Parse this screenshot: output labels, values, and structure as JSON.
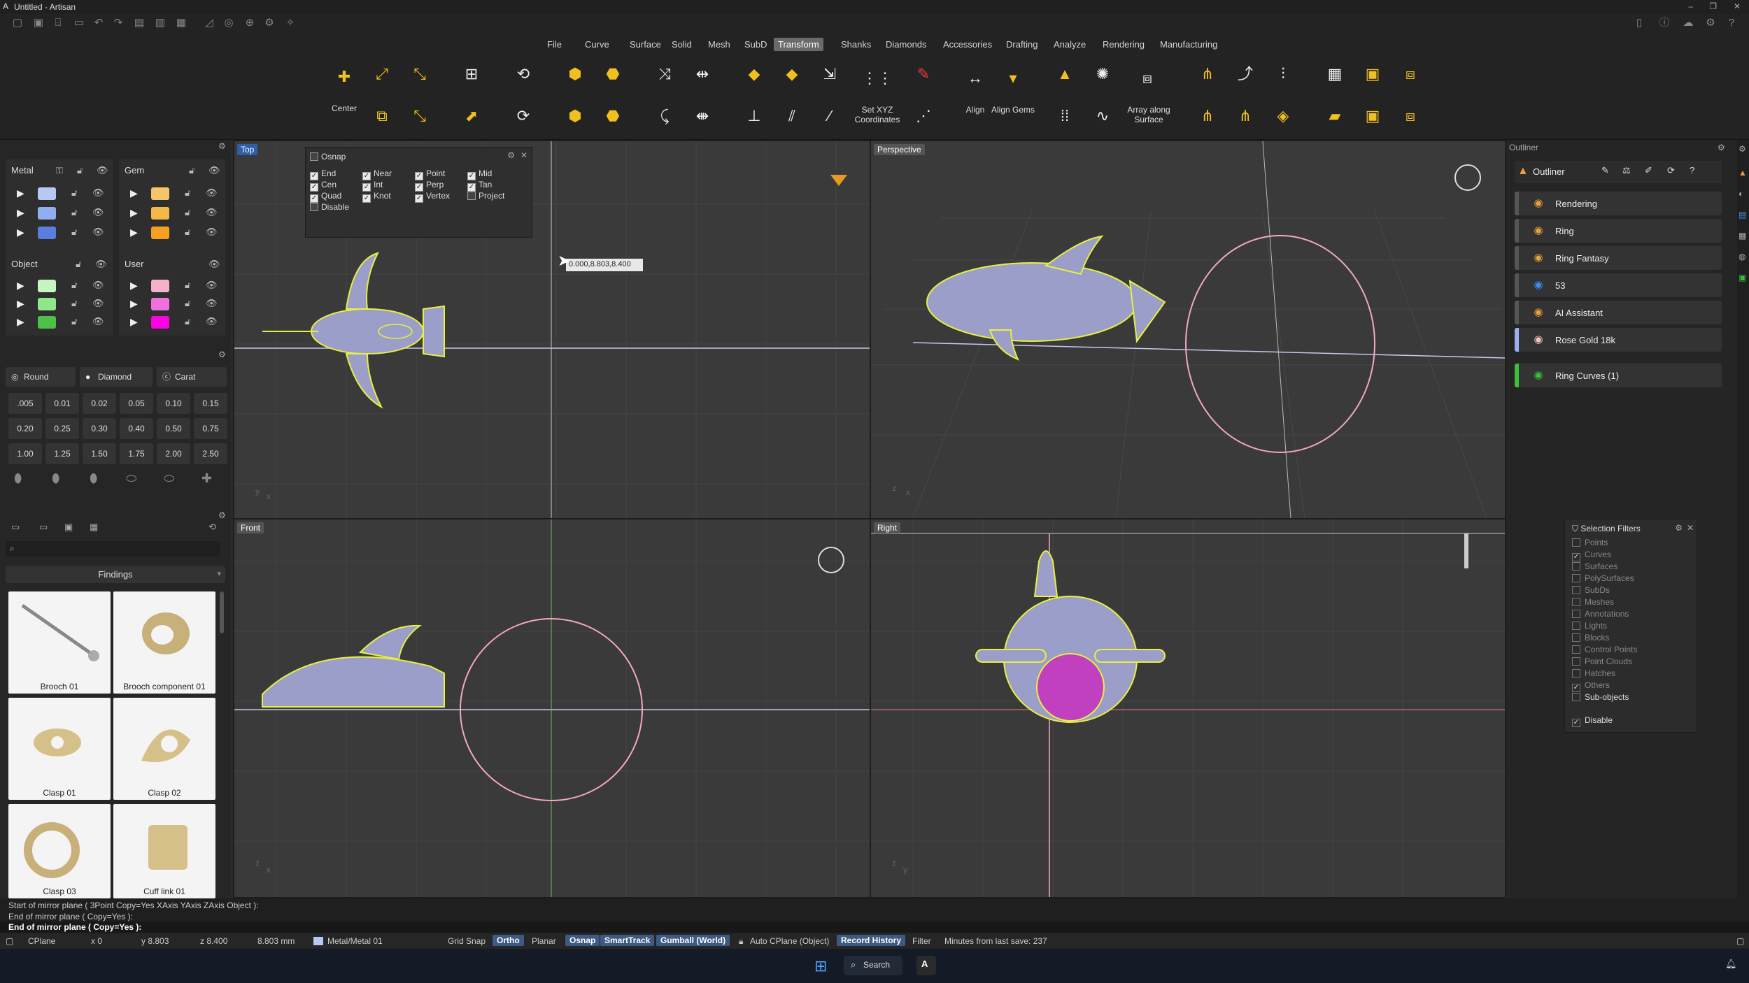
{
  "app": {
    "window_title": "Untitled - Artisan"
  },
  "menu": {
    "items": [
      "File",
      "Curve",
      "Surface",
      "Solid",
      "Mesh",
      "SubD",
      "Transform",
      "Shanks",
      "Diamonds",
      "Accessories",
      "Drafting",
      "Analyze",
      "Rendering",
      "Manufacturing"
    ],
    "active": "Transform"
  },
  "ribbon": {
    "center_label": "Center",
    "set_xyz_label": "Set XYZ Coordinates",
    "align_label": "Align",
    "align_gems_label": "Align Gems",
    "array_label": "Array along Surface"
  },
  "layers": {
    "metal": {
      "title": "Metal",
      "colors": [
        "#b8c8f4",
        "#90aef0",
        "#5a7ee0"
      ]
    },
    "gem": {
      "title": "Gem",
      "colors": [
        "#f5c56a",
        "#f5b74a",
        "#f5a020"
      ]
    },
    "object": {
      "title": "Object",
      "colors": [
        "#c6f5c2",
        "#8ee88a",
        "#4ec04a"
      ]
    },
    "user": {
      "title": "User",
      "colors": [
        "#f5b0cc",
        "#f070e0",
        "#ff00e0"
      ]
    }
  },
  "gem_tools": {
    "round": "Round",
    "diamond": "Diamond",
    "carat": "Carat",
    "sizes": [
      ".005",
      "0.01",
      "0.02",
      "0.05",
      "0.10",
      "0.15",
      "0.20",
      "0.25",
      "0.30",
      "0.40",
      "0.50",
      "0.75",
      "1.00",
      "1.25",
      "1.50",
      "1.75",
      "2.00",
      "2.50"
    ]
  },
  "library": {
    "search_placeholder": "",
    "category": "Findings",
    "items": [
      "Brooch 01",
      "Brooch component 01",
      "Clasp 01",
      "Clasp 02",
      "Clasp 03",
      "Cuff link 01"
    ]
  },
  "viewports": {
    "top": "Top",
    "perspective": "Perspective",
    "front": "Front",
    "right": "Right",
    "cursor_tooltip": "0.000,8.803,8.400"
  },
  "osnap": {
    "title": "Osnap",
    "col1": [
      {
        "label": "End",
        "on": true
      },
      {
        "label": "Cen",
        "on": true
      },
      {
        "label": "Quad",
        "on": true
      },
      {
        "label": "Disable",
        "on": false
      }
    ],
    "col2": [
      {
        "label": "Near",
        "on": true
      },
      {
        "label": "Int",
        "on": true
      },
      {
        "label": "Knot",
        "on": true
      }
    ],
    "col3": [
      {
        "label": "Point",
        "on": true
      },
      {
        "label": "Perp",
        "on": true
      },
      {
        "label": "Vertex",
        "on": true
      }
    ],
    "col4": [
      {
        "label": "Mid",
        "on": true
      },
      {
        "label": "Tan",
        "on": true
      },
      {
        "label": "Project",
        "on": false
      }
    ]
  },
  "outliner": {
    "title": "Outliner",
    "panel_label": "Outliner",
    "rows": [
      {
        "label": "Rendering",
        "bar": "#555",
        "icon": "#e8a040"
      },
      {
        "label": "Ring",
        "bar": "#555",
        "icon": "#e8a040"
      },
      {
        "label": "Ring Fantasy",
        "bar": "#555",
        "icon": "#e8a040"
      },
      {
        "label": "53",
        "bar": "#555",
        "icon": "#3a8ff0"
      },
      {
        "label": "AI Assistant",
        "bar": "#555",
        "icon": "#e8a040"
      },
      {
        "label": "Rose Gold 18k",
        "bar": "#9bb0f0",
        "icon": "#f4c0c0"
      },
      {
        "label": "Ring Curves (1)",
        "bar": "#3cc03c",
        "icon": "#3cc03c"
      }
    ]
  },
  "selection_filters": {
    "title": "Selection Filters",
    "items": [
      {
        "label": "Points",
        "on": false
      },
      {
        "label": "Curves",
        "on": true
      },
      {
        "label": "Surfaces",
        "on": false
      },
      {
        "label": "PolySurfaces",
        "on": false
      },
      {
        "label": "SubDs",
        "on": false
      },
      {
        "label": "Meshes",
        "on": false
      },
      {
        "label": "Annotations",
        "on": false
      },
      {
        "label": "Lights",
        "on": false
      },
      {
        "label": "Blocks",
        "on": false
      },
      {
        "label": "Control Points",
        "on": false
      },
      {
        "label": "Point Clouds",
        "on": false
      },
      {
        "label": "Hatches",
        "on": false
      },
      {
        "label": "Others",
        "on": true
      },
      {
        "label": "Sub-objects",
        "on": false
      }
    ],
    "disable": "Disable"
  },
  "command": {
    "line1": "Start of mirror plane ( 3Point  Copy=Yes  XAxis  YAxis  ZAxis  Object ):",
    "line2": "End of mirror plane ( Copy=Yes ):",
    "prompt": "End of mirror plane ( Copy=Yes ):"
  },
  "status": {
    "cplane": "CPlane",
    "x": "x 0",
    "y": "y 8.803",
    "z": "z 8.400",
    "dist": "8.803 mm",
    "layer": "Metal/Metal 01",
    "grid_snap": "Grid Snap",
    "ortho": "Ortho",
    "planar": "Planar",
    "osnap": "Osnap",
    "smarttrack": "SmartTrack",
    "gumball": "Gumball (World)",
    "auto_cplane": "Auto CPlane (Object)",
    "record_history": "Record History",
    "filter": "Filter",
    "minutes": "Minutes from last save: 237"
  },
  "taskbar": {
    "search": "Search"
  }
}
